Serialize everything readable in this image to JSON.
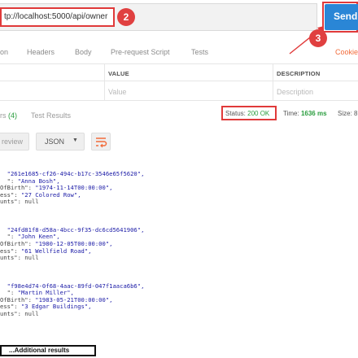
{
  "request": {
    "url": "tp://localhost:5000/api/owner",
    "send_label": "Send"
  },
  "annotations": {
    "badge_url": "2",
    "badge_send": "3",
    "more_results": "...Additional results"
  },
  "request_tabs": [
    "on",
    "Headers",
    "Body",
    "Pre-request Script",
    "Tests"
  ],
  "cookies_label": "Cookie",
  "params_table": {
    "columns": [
      "VALUE",
      "DESCRIPTION"
    ],
    "placeholders": [
      "Value",
      "Description"
    ]
  },
  "response_tabs": {
    "headers_label": "rs",
    "headers_count": "(4)",
    "test_results": "Test Results"
  },
  "response_meta": {
    "status_label": "Status:",
    "status_value": "200 OK",
    "time_label": "Time:",
    "time_value": "1636 ms",
    "size_label": "Size: 8"
  },
  "format_toolbar": {
    "preview_label": "review",
    "format_value": "JSON",
    "wrap_icon": "wrap-lines-icon"
  },
  "body_lines": [
    [
      {
        "key": "  ",
        "val": "\"261e1685-cf26-494c-b17c-3546e65f5620\","
      },
      {
        "key": "  \": ",
        "val": "\"Anna Bosh\","
      },
      {
        "key": "OfBirth\": ",
        "val": "\"1974-11-14T00:00:00\","
      },
      {
        "key": "ess\": ",
        "val": "\"27 Colored Row\","
      },
      {
        "key": "unts\": null",
        "val": ""
      }
    ],
    [
      {
        "key": "  ",
        "val": "\"24fd81f8-d58a-4bcc-9f35-dc6cd5641906\","
      },
      {
        "key": "  \": ",
        "val": "\"John Keen\","
      },
      {
        "key": "OfBirth\": ",
        "val": "\"1980-12-05T00:00:00\","
      },
      {
        "key": "ess\": ",
        "val": "\"61 Wellfield Road\","
      },
      {
        "key": "unts\": null",
        "val": ""
      }
    ],
    [
      {
        "key": "  ",
        "val": "\"f98e4d74-0f68-4aac-89fd-047f1aaca6b6\","
      },
      {
        "key": "  \": ",
        "val": "\"Martin Miller\","
      },
      {
        "key": "OfBirth\": ",
        "val": "\"1983-05-21T00:00:00\","
      },
      {
        "key": "ess\": ",
        "val": "\"3 Edgar Buildings\","
      },
      {
        "key": "unts\": null",
        "val": ""
      }
    ]
  ],
  "colors": {
    "send": "#2a86d6",
    "annotation": "#e03a3a",
    "status_ok": "#2a9d3e",
    "cookies": "#f26b3a",
    "json_string": "#1a1aa6"
  }
}
